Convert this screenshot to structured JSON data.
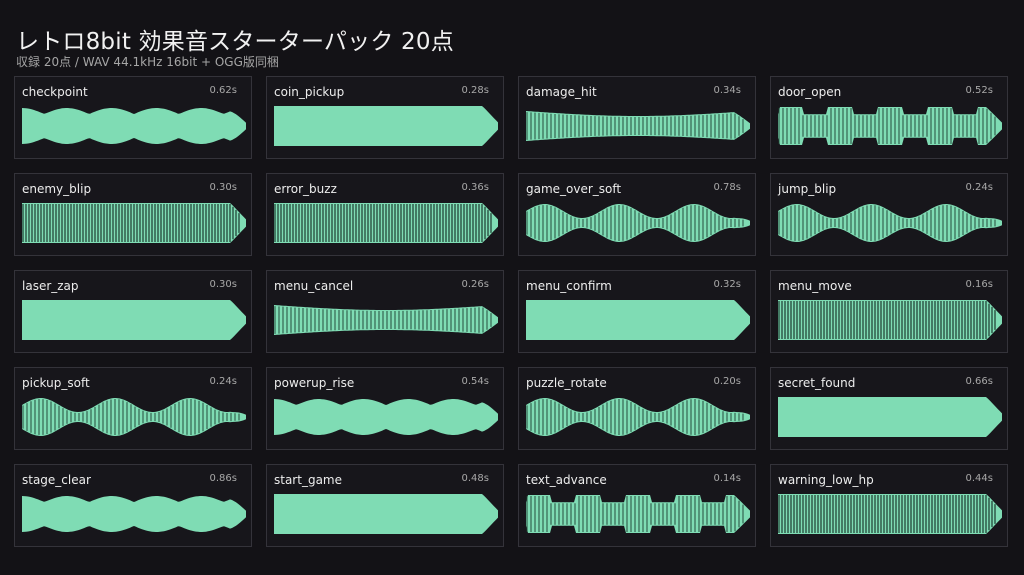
{
  "header": {
    "title": "レトロ8bit 効果音スターターパック 20点",
    "subtitle": "収録 20点  /  WAV 44.1kHz 16bit  +  OGG版同梱"
  },
  "colors": {
    "background": "#131216",
    "card_border": "#34333a",
    "waveform": "#7fdcb4",
    "waveform_dark": "#1c3a2e"
  },
  "sounds": [
    {
      "name": "checkpoint",
      "duration": "0.62s"
    },
    {
      "name": "coin_pickup",
      "duration": "0.28s"
    },
    {
      "name": "damage_hit",
      "duration": "0.34s"
    },
    {
      "name": "door_open",
      "duration": "0.52s"
    },
    {
      "name": "enemy_blip",
      "duration": "0.30s"
    },
    {
      "name": "error_buzz",
      "duration": "0.36s"
    },
    {
      "name": "game_over_soft",
      "duration": "0.78s"
    },
    {
      "name": "jump_blip",
      "duration": "0.24s"
    },
    {
      "name": "laser_zap",
      "duration": "0.30s"
    },
    {
      "name": "menu_cancel",
      "duration": "0.26s"
    },
    {
      "name": "menu_confirm",
      "duration": "0.32s"
    },
    {
      "name": "menu_move",
      "duration": "0.16s"
    },
    {
      "name": "pickup_soft",
      "duration": "0.24s"
    },
    {
      "name": "powerup_rise",
      "duration": "0.54s"
    },
    {
      "name": "puzzle_rotate",
      "duration": "0.20s"
    },
    {
      "name": "secret_found",
      "duration": "0.66s"
    },
    {
      "name": "stage_clear",
      "duration": "0.86s"
    },
    {
      "name": "start_game",
      "duration": "0.48s"
    },
    {
      "name": "text_advance",
      "duration": "0.14s"
    },
    {
      "name": "warning_low_hp",
      "duration": "0.44s"
    }
  ]
}
